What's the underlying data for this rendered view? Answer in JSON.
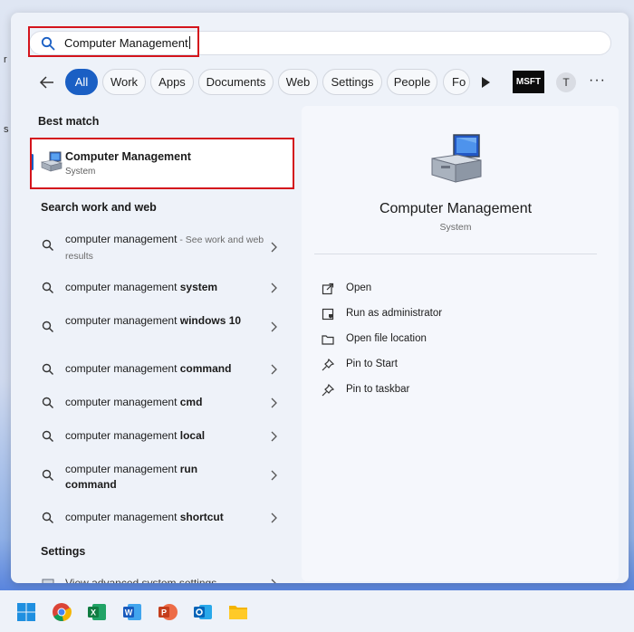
{
  "desktop": {
    "letters": [
      "r",
      "s"
    ]
  },
  "search": {
    "value": "Computer Management"
  },
  "filters": {
    "chips": [
      "All",
      "Work",
      "Apps",
      "Documents",
      "Web",
      "Settings",
      "People",
      "Fo"
    ],
    "msft_badge": "MSFT",
    "avatar_initial": "T",
    "more": "···"
  },
  "best_match": {
    "heading": "Best match",
    "title": "Computer Management",
    "subtitle": "System"
  },
  "web_section": {
    "heading": "Search work and web"
  },
  "results": [
    {
      "pre": "computer management",
      "bold": "",
      "suffix": " - See work and web results"
    },
    {
      "pre": "computer management ",
      "bold": "system",
      "suffix": ""
    },
    {
      "pre": "computer management ",
      "bold": "windows 10",
      "suffix": ""
    },
    {
      "pre": "computer management ",
      "bold": "command",
      "suffix": ""
    },
    {
      "pre": "computer management ",
      "bold": "cmd",
      "suffix": ""
    },
    {
      "pre": "computer management ",
      "bold": "local",
      "suffix": ""
    },
    {
      "pre": "computer management ",
      "bold": "run command",
      "suffix": ""
    },
    {
      "pre": "computer management ",
      "bold": "shortcut",
      "suffix": ""
    }
  ],
  "settings_section": {
    "heading": "Settings",
    "partial_item": "View advanced system settings"
  },
  "details": {
    "title": "Computer Management",
    "subtitle": "System",
    "actions": [
      "Open",
      "Run as administrator",
      "Open file location",
      "Pin to Start",
      "Pin to taskbar"
    ]
  },
  "taskbar": {
    "icons": [
      "start-icon",
      "chrome-icon",
      "excel-icon",
      "word-icon",
      "powerpoint-icon",
      "outlook-icon",
      "file-explorer-icon"
    ]
  },
  "colors": {
    "accent": "#1a5fc4",
    "highlight_box": "#d4141c"
  }
}
